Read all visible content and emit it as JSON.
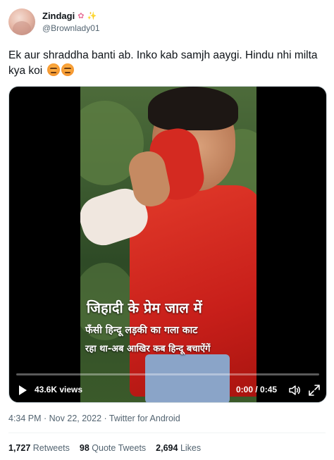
{
  "user": {
    "name": "Zindagi",
    "handle": "@Brownlady01",
    "name_emojis": [
      "✿",
      "✨"
    ]
  },
  "tweet": {
    "text": "Ek aur shraddha banti ab. Inko kab samjh aaygi. Hindu nhi milta kya koi",
    "emojis": [
      "angry-face",
      "angry-face"
    ]
  },
  "video": {
    "caption_line1": "जिहादी के प्रेम जाल में",
    "caption_line2": "फँसी हिन्दू लड़की का गला काट",
    "caption_line3": "रहा था-अब आखिर कब हिन्दू बचाऐंगें",
    "views": "43.6K views",
    "time": "0:00 / 0:45",
    "progress": 0,
    "icons": [
      "play-icon",
      "volume-icon",
      "expand-icon"
    ]
  },
  "meta": {
    "timestamp": "4:34 PM · Nov 22, 2022 · Twitter for Android"
  },
  "stats": {
    "retweets_count": "1,727",
    "retweets_label": "Retweets",
    "quotes_count": "98",
    "quotes_label": "Quote Tweets",
    "likes_count": "2,694",
    "likes_label": "Likes"
  },
  "colors": {
    "text_primary": "#0f1419",
    "text_secondary": "#536471",
    "shirt_red": "#c81f1a",
    "video_bg": "#000000"
  }
}
